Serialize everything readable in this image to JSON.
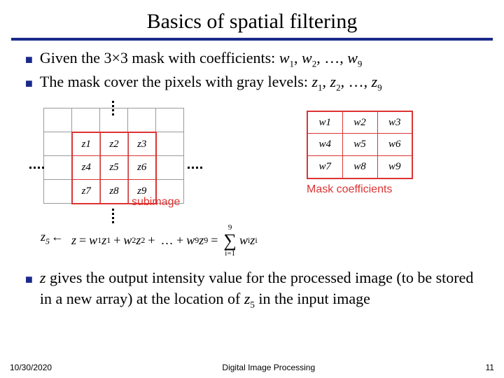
{
  "title": "Basics of spatial filtering",
  "bullets": {
    "b1_prefix": "Given the 3×3 mask with coefficients: ",
    "b1_w_pre": "w",
    "b1_w_s1": "1",
    "b1_sep": ", ",
    "b1_w_s2": "2",
    "b1_mid": ", …, ",
    "b1_w_s9": "9",
    "b2_prefix": "The mask cover the pixels with gray levels: ",
    "b2_z_pre": "z",
    "b2_z_s1": "1",
    "b2_z_s2": "2",
    "b2_z_s9": "9"
  },
  "subimage": {
    "cells": [
      "z1",
      "z2",
      "z3",
      "z4",
      "z5",
      "z6",
      "z7",
      "z8",
      "z9"
    ],
    "label": "subimage"
  },
  "mask": {
    "cells": [
      "w1",
      "w2",
      "w3",
      "w4",
      "w5",
      "w6",
      "w7",
      "w8",
      "w9"
    ],
    "label": "Mask coefficients"
  },
  "formula": {
    "lhs_var": "z",
    "lhs_sub": "5",
    "arrow": "←",
    "zvar": "z",
    "eq": "=",
    "w": "w",
    "z": "z",
    "s1": "1",
    "s2": "2",
    "s9": "9",
    "plus": "+",
    "dots": "… +",
    "sum_top": "9",
    "sum_bot": "i=1",
    "sum_w": "w",
    "sum_i": "i",
    "sum_z": "z"
  },
  "last": {
    "pre": "",
    "zvar": "z",
    "text1": " gives the output intensity value for the processed image (to be stored in a new array) at the location of ",
    "z5": "z",
    "z5s": "5",
    "text2": " in the input image"
  },
  "footer": {
    "date": "10/30/2020",
    "course": "Digital Image Processing",
    "page": "11"
  }
}
